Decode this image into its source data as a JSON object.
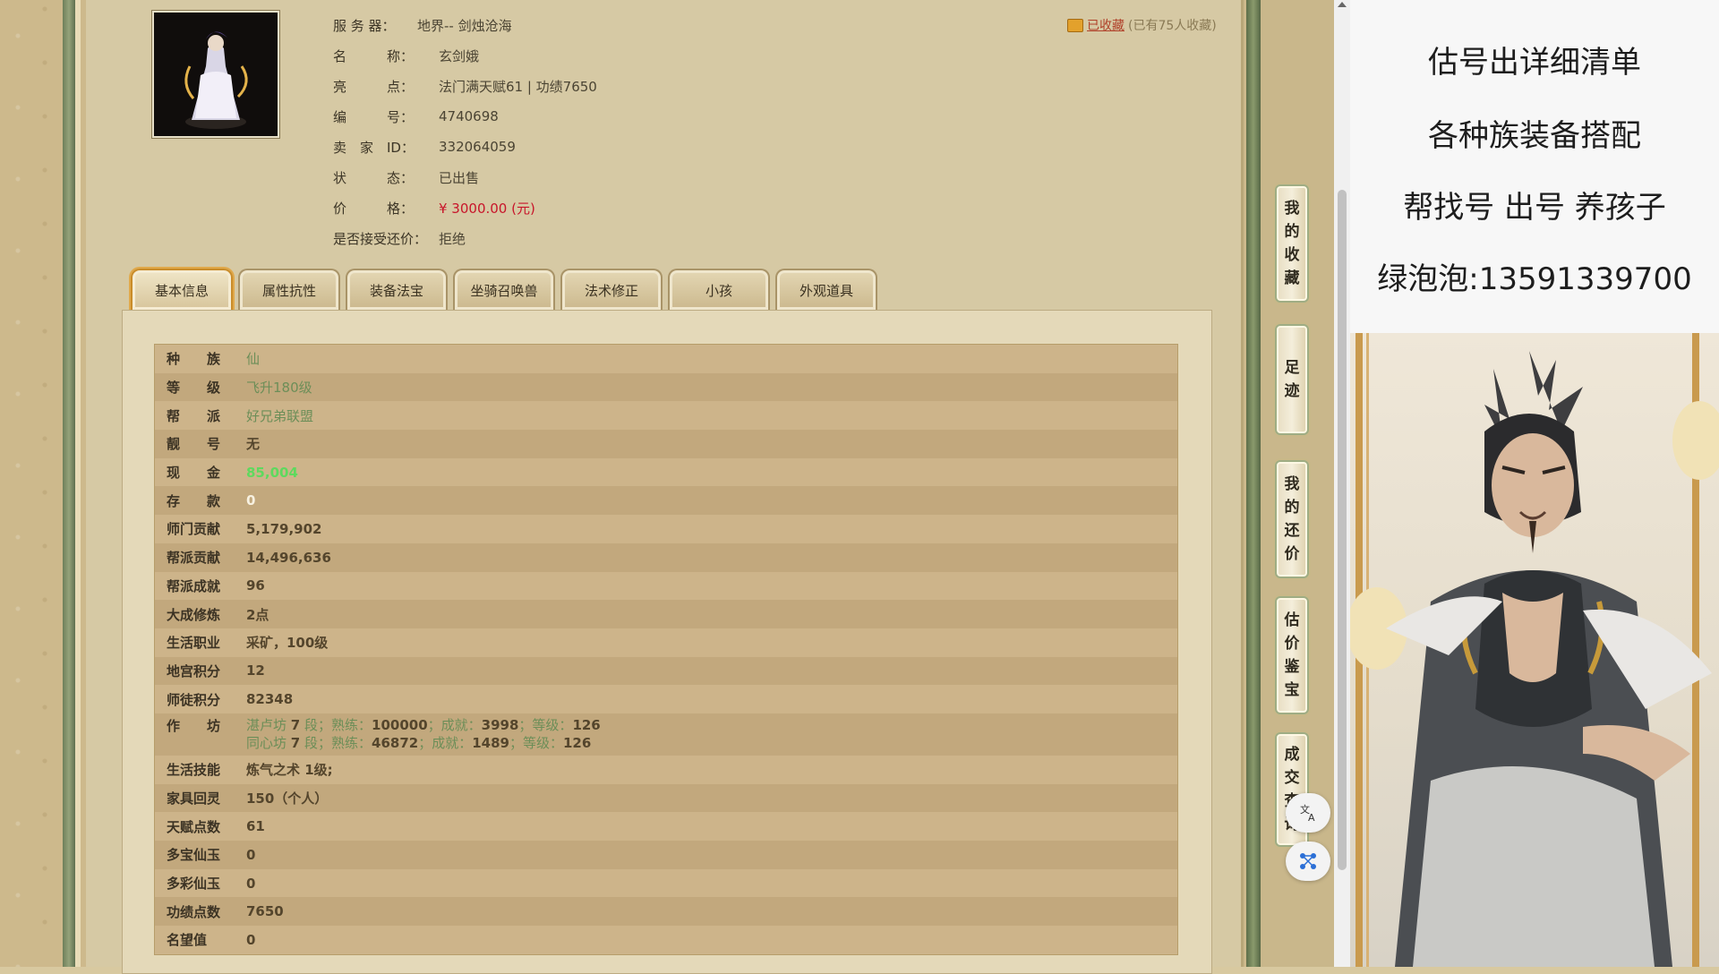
{
  "header": {
    "server_label": "服 务 器：",
    "server_value": "地界-- 剑烛沧海",
    "name_label": "名　　　称：",
    "name_value": "玄剑娥",
    "highlight_label": "亮　　　点：",
    "highlight_value": "法门满天赋61 | 功绩7650",
    "number_label": "编　　　号：",
    "number_value": "4740698",
    "seller_label": "卖　家　ID：",
    "seller_value": "332064059",
    "status_label": "状　　　态：",
    "status_value": "已出售",
    "price_label": "价　　　格：",
    "price_value": "¥ 3000.00 (元)",
    "counter_label": "是否接受还价：",
    "counter_value": "拒绝",
    "fav_link": "已收藏",
    "fav_count": "(已有75人收藏)"
  },
  "tabs": [
    "基本信息",
    "属性抗性",
    "装备法宝",
    "坐骑召唤兽",
    "法术修正",
    "小孩",
    "外观道具"
  ],
  "table": {
    "rows": [
      {
        "key": "种　　族",
        "value": "仙",
        "style": "green"
      },
      {
        "key": "等　　级",
        "value": "飞升180级",
        "style": "green"
      },
      {
        "key": "帮　　派",
        "value": "好兄弟联盟",
        "style": "green"
      },
      {
        "key": "靓　　号",
        "value": "无",
        "style": ""
      },
      {
        "key": "现　　金",
        "value": "85,004",
        "style": "bright"
      },
      {
        "key": "存　　款",
        "value": "0",
        "style": "white"
      },
      {
        "key": "师门贡献",
        "value": "5,179,902",
        "style": ""
      },
      {
        "key": "帮派贡献",
        "value": "14,496,636",
        "style": ""
      },
      {
        "key": "帮派成就",
        "value": "96",
        "style": ""
      },
      {
        "key": "大成修炼",
        "value": "2点",
        "style": ""
      },
      {
        "key": "生活职业",
        "value": "采矿，100级",
        "style": ""
      },
      {
        "key": "地宫积分",
        "value": "12",
        "style": ""
      },
      {
        "key": "师徒积分",
        "value": "82348",
        "style": ""
      }
    ],
    "workshop_key": "作　　坊",
    "workshop": [
      {
        "name": "湛卢坊",
        "seg": "7",
        "seg_unit": "段；熟练：",
        "skill": "100000",
        "ach_label": "；成就：",
        "ach": "3998",
        "lvl_label": "；等级：",
        "lvl": "126"
      },
      {
        "name": "同心坊",
        "seg": "7",
        "seg_unit": "段；熟练：",
        "skill": "46872",
        "ach_label": "；成就：",
        "ach": "1489",
        "lvl_label": "；等级：",
        "lvl": "126"
      }
    ],
    "rows2": [
      {
        "key": "生活技能",
        "value": "炼气之术 1级;"
      },
      {
        "key": "家具回灵",
        "value": "150（个人）"
      },
      {
        "key": "天赋点数",
        "value": "61"
      },
      {
        "key": "多宝仙玉",
        "value": "0"
      },
      {
        "key": "多彩仙玉",
        "value": "0"
      },
      {
        "key": "功绩点数",
        "value": "7650"
      },
      {
        "key": "名望值",
        "value": "0"
      }
    ]
  },
  "side_tabs": [
    {
      "chars": [
        "我",
        "的",
        "收",
        "藏"
      ]
    },
    {
      "chars": [
        "足",
        "迹"
      ]
    },
    {
      "chars": [
        "我",
        "的",
        "还",
        "价"
      ]
    },
    {
      "chars": [
        "估",
        "价",
        "鉴",
        "宝"
      ]
    },
    {
      "chars": [
        "成",
        "交",
        "查",
        "询"
      ]
    }
  ],
  "floating": {
    "translate_icon": "translate-icon",
    "network_icon": "network-icon"
  },
  "ad": {
    "line1": "估号出详细清单",
    "line2": "各种族装备搭配",
    "line3": "帮找号 出号 养孩子",
    "line4": "绿泡泡:13591339700"
  }
}
